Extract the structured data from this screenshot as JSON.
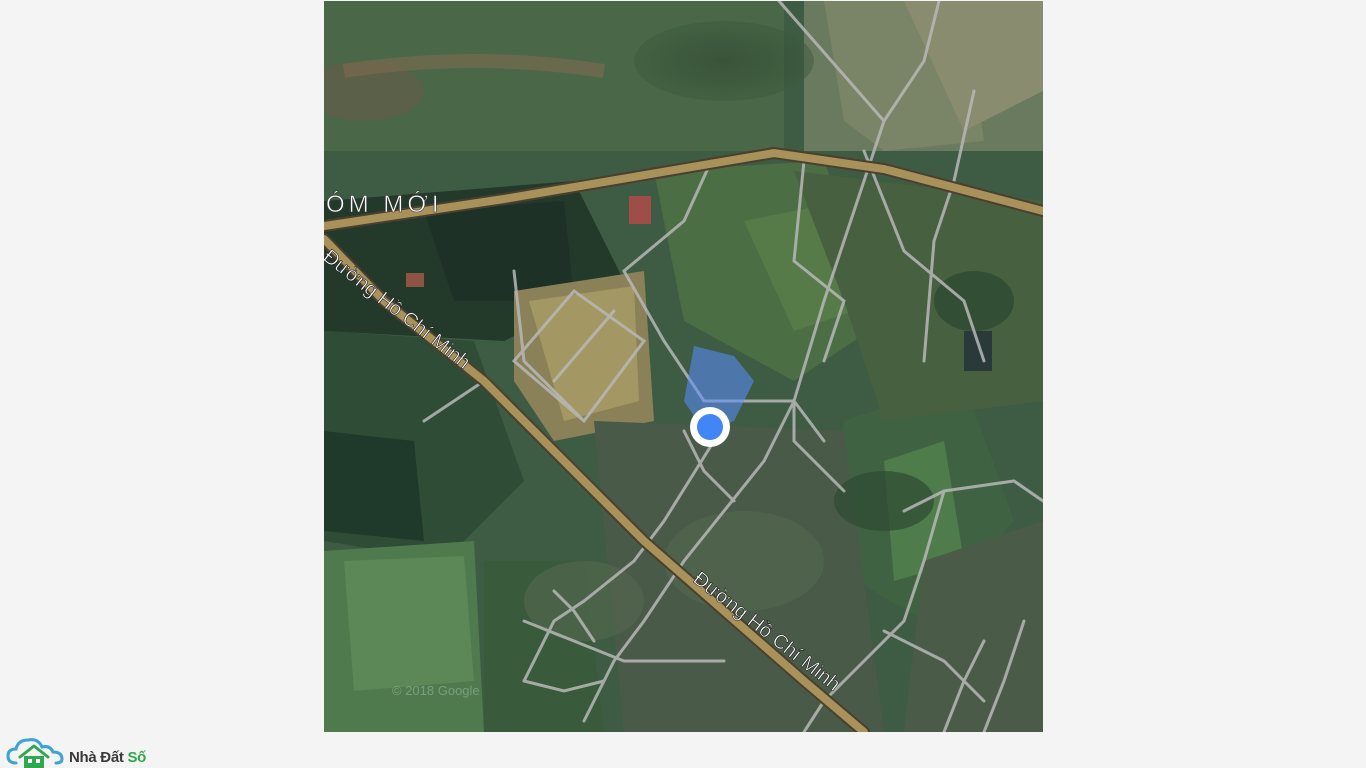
{
  "map": {
    "area_label": "ÓM MỚI",
    "road_label": "Đường Hồ Chí Minh",
    "copyright": "© 2018 Google",
    "colors": {
      "road_major": "#a8925a",
      "road_minor": "#b8b8b8",
      "location_dot": "#4285f4",
      "accuracy_area": "#5a8cff"
    }
  },
  "brand": {
    "name_main": "Nhà Đất ",
    "name_accent": "Số",
    "icon": "house-cloud-icon"
  }
}
